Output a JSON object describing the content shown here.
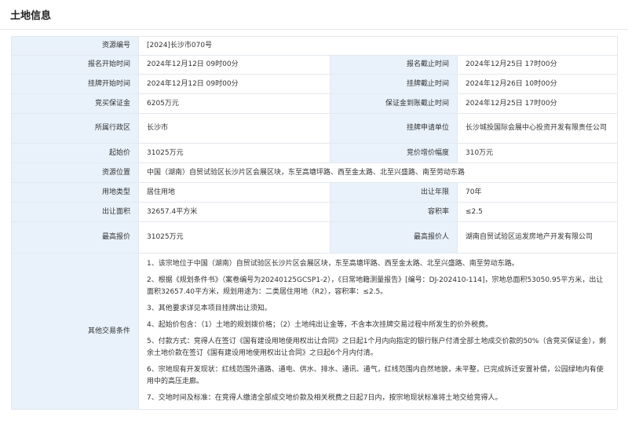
{
  "header": {
    "title": "土地信息"
  },
  "rows": {
    "resource_no": {
      "label": "资源编号",
      "value": "[2024]长沙市070号"
    },
    "reg_start": {
      "label": "报名开始时间",
      "value": "2024年12月12日 09时00分"
    },
    "reg_end": {
      "label": "报名截止时间",
      "value": "2024年12月25日 17时00分"
    },
    "list_start": {
      "label": "挂牌开始时间",
      "value": "2024年12月12日 09时00分"
    },
    "list_end": {
      "label": "挂牌截止时间",
      "value": "2024年12月26日 10时00分"
    },
    "deposit": {
      "label": "竞买保证金",
      "value": "6205万元"
    },
    "deposit_deadline": {
      "label": "保证金到账截止时间",
      "value": "2024年12月25日 17时00分"
    },
    "district": {
      "label": "所属行政区",
      "value": "长沙市"
    },
    "applicant": {
      "label": "挂牌申请单位",
      "value": "长沙城投国际会展中心投资开发有限责任公司"
    },
    "start_price": {
      "label": "起始价",
      "value": "31025万元"
    },
    "increment": {
      "label": "竞价增价幅度",
      "value": "310万元"
    },
    "location": {
      "label": "资源位置",
      "value": "中国（湖南）自贸试验区长沙片区会展区块，东至高塘坪路、西至金太路、北至兴盛路、南至劳动东路"
    },
    "land_use": {
      "label": "用地类型",
      "value": "居住用地"
    },
    "term": {
      "label": "出让年限",
      "value": "70年"
    },
    "area": {
      "label": "出让面积",
      "value": "32657.4平方米"
    },
    "far": {
      "label": "容积率",
      "value": "≤2.5"
    },
    "top_price": {
      "label": "最高报价",
      "value": "31025万元"
    },
    "top_bidder": {
      "label": "最高报价人",
      "value": "湖南自贸试验区运发房地产开发有限公司"
    },
    "other": {
      "label": "其他交易条件",
      "notes": [
        "1、该宗地位于中国（湖南）自贸试验区长沙片区会展区块，东至高塘坪路、西至金太路、北至兴盛路、南至劳动东路。",
        "2、根据《规划条件书》（案卷编号为20240125GCSP1-2），《日常地籍测量报告》[编号：DJ-202410-114]，宗地总面积53050.95平方米，出让面积32657.40平方米，规划用途为：二类居住用地（R2），容积率：≤2.5。",
        "3、其他要求详见本项目挂牌出让须知。",
        "4、起始价包含：（1）土地的规划拨价格；（2）土地纯出让金等，不含本次挂牌交易过程中所发生的价外税费。",
        "5、付款方式：竞得人在签订《国有建设用地使用权出让合同》之日起1个月内向指定的银行账户付清全部土地成交价款的50%（含竞买保证金），剩余土地价款在签订《国有建设用地使用权出让合同》之日起6个月内付清。",
        "6、宗地现有开发现状：红线范围外通路、通电、供水、排水、通讯、通气，红线范围内自然地貌，未平整，已完成拆迁安置补偿，公园绿地内有使用中的高压走廊。",
        "7、交地时间及标准：在竞得人缴清全部成交地价款及相关税费之日起7日内，按宗地现状标准将土地交给竞得人。"
      ]
    }
  }
}
